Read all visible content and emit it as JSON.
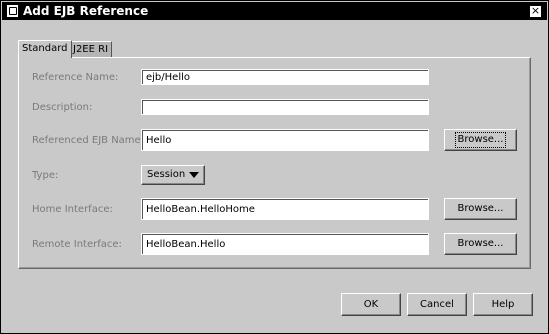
{
  "window": {
    "title": "Add EJB Reference",
    "close_glyph": "×"
  },
  "tabs": [
    {
      "label": "Standard",
      "active": true
    },
    {
      "label": "J2EE RI",
      "active": false
    }
  ],
  "form": {
    "reference_name": {
      "label": "Reference Name:",
      "value": "ejb/Hello"
    },
    "description": {
      "label": "Description:",
      "value": ""
    },
    "referenced_ejb_name": {
      "label": "Referenced EJB Name:",
      "value": "Hello"
    },
    "type": {
      "label": "Type:",
      "value": "Session"
    },
    "home_interface": {
      "label": "Home Interface:",
      "value": "HelloBean.HelloHome"
    },
    "remote_interface": {
      "label": "Remote Interface:",
      "value": "HelloBean.Hello"
    }
  },
  "buttons": {
    "browse_label": "Browse...",
    "ok_label": "OK",
    "cancel_label": "Cancel",
    "help_label": "Help"
  },
  "icons": {
    "title": "window-app-icon",
    "close": "close-icon",
    "dropdown": "chevron-down-icon"
  }
}
